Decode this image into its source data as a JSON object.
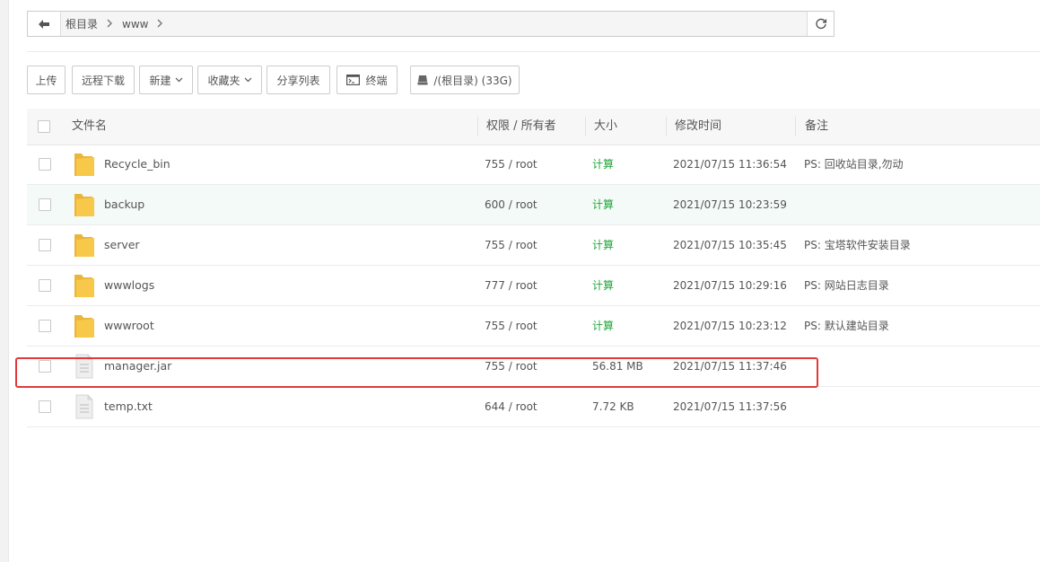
{
  "path": {
    "crumbs": [
      "根目录",
      "www"
    ]
  },
  "toolbar": {
    "upload": "上传",
    "remote_download": "远程下载",
    "new": "新建",
    "favorites": "收藏夹",
    "share_list": "分享列表",
    "terminal": "终端",
    "disk": "/(根目录) (33G)"
  },
  "table": {
    "headers": {
      "name": "文件名",
      "perm": "权限 / 所有者",
      "size": "大小",
      "mtime": "修改时间",
      "note": "备注"
    },
    "rows": [
      {
        "name": "Recycle_bin",
        "type": "folder",
        "perm": "755 / root",
        "size": "计算",
        "mtime": "2021/07/15 11:36:54",
        "note": "PS: 回收站目录,勿动"
      },
      {
        "name": "backup",
        "type": "folder",
        "perm": "600 / root",
        "size": "计算",
        "mtime": "2021/07/15 10:23:59",
        "note": ""
      },
      {
        "name": "server",
        "type": "folder",
        "perm": "755 / root",
        "size": "计算",
        "mtime": "2021/07/15 10:35:45",
        "note": "PS: 宝塔软件安装目录"
      },
      {
        "name": "wwwlogs",
        "type": "folder",
        "perm": "777 / root",
        "size": "计算",
        "mtime": "2021/07/15 10:29:16",
        "note": "PS: 网站日志目录"
      },
      {
        "name": "wwwroot",
        "type": "folder",
        "perm": "755 / root",
        "size": "计算",
        "mtime": "2021/07/15 10:23:12",
        "note": "PS: 默认建站目录"
      },
      {
        "name": "manager.jar",
        "type": "file",
        "perm": "755 / root",
        "size": "56.81 MB",
        "mtime": "2021/07/15 11:37:46",
        "note": ""
      },
      {
        "name": "temp.txt",
        "type": "file",
        "perm": "644 / root",
        "size": "7.72 KB",
        "mtime": "2021/07/15 11:37:56",
        "note": ""
      }
    ]
  },
  "colors": {
    "calc_link": "#20a53a",
    "highlight_box": "#e23a3a",
    "hover_row": "#f3faf7",
    "folder": "#f7c84a"
  }
}
